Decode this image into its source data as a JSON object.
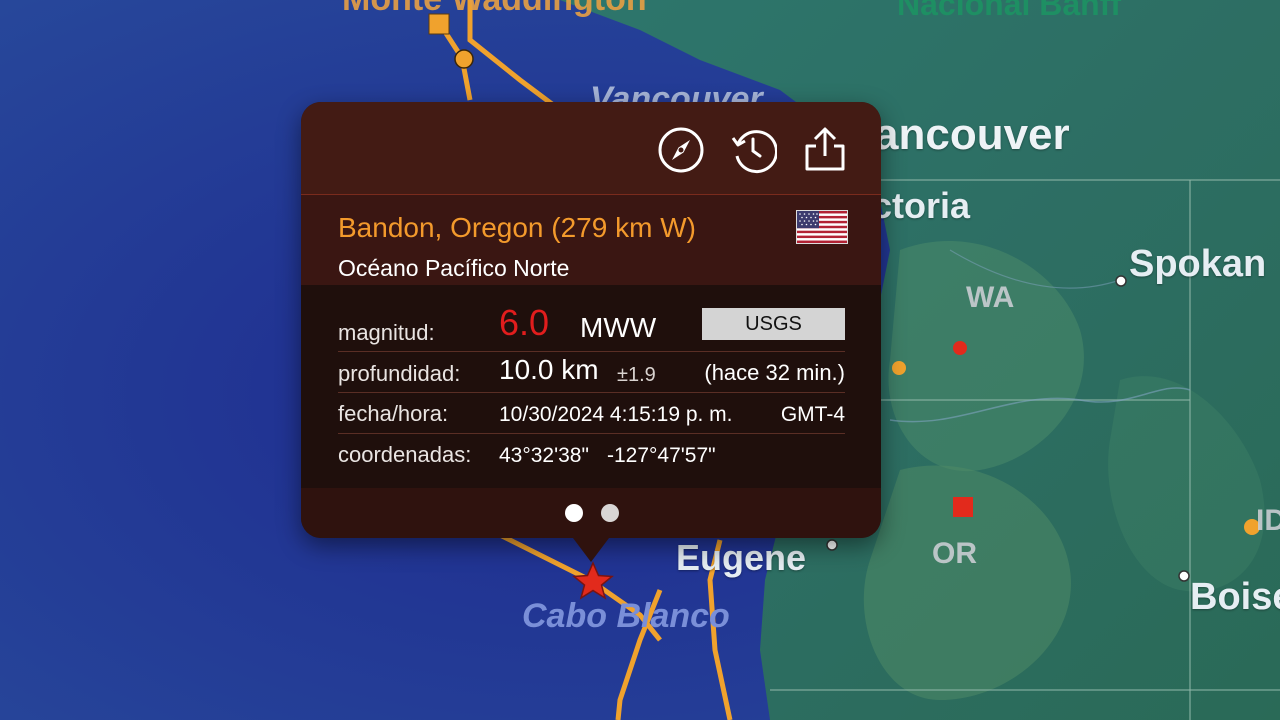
{
  "map": {
    "labels": {
      "monte_waddington": "Monte Waddington",
      "nacional_banff": "Nacional Banff",
      "vancouver_faint": "Vancouver",
      "vancouver": "ancouver",
      "victoria": "ctoria",
      "spokane": "Spokan",
      "wa": "WA",
      "or": "OR",
      "id": "ID",
      "eugene": "Eugene",
      "cabo_blanco": "Cabo Blanco",
      "boise": "Boise"
    },
    "colors": {
      "ocean": "#1f3a8a",
      "land": "#2f6d66",
      "fault_line": "#f0a22d",
      "epicenter": "#e22a1c"
    }
  },
  "popup": {
    "toolbar": {
      "compass_icon": "compass-icon",
      "history_icon": "history-icon",
      "share_icon": "share-icon"
    },
    "location": "Bandon, Oregon (279 km W)",
    "region": "Océano Pacífico Norte",
    "flag_icon": "us-flag-icon",
    "labels": {
      "magnitude": "magnitud:",
      "depth": "profundidad:",
      "datetime": "fecha/hora:",
      "coords": "coordenadas:"
    },
    "magnitude_value": "6.0",
    "magnitude_type": "MWW",
    "source": "USGS",
    "depth_value": "10.0 km",
    "depth_uncertainty": "±1.9",
    "time_ago": "(hace 32 min.)",
    "datetime": "10/30/2024 4:15:19 p. m.",
    "timezone": "GMT-4",
    "lat": "43°32'38\"",
    "lon": "-127°47'57\"",
    "pager": {
      "pages": 2,
      "current": 1
    },
    "colors": {
      "accent": "#f39a2c",
      "magnitude": "#e11d1d"
    }
  }
}
